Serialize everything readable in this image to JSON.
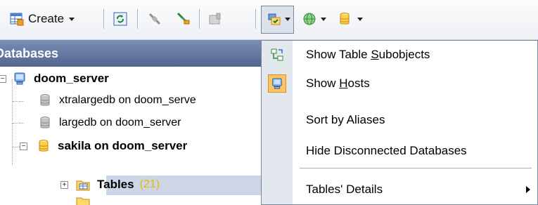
{
  "toolbar": {
    "create_label": "Create",
    "buttons": [
      {
        "icon": "create-table-icon",
        "caret": true
      },
      {
        "icon": "refresh-icon"
      },
      {
        "icon": "disconnect-icon"
      },
      {
        "icon": "connect-icon"
      },
      {
        "icon": "properties-icon"
      },
      {
        "icon": "view-options-icon",
        "caret": true,
        "pressed": true
      },
      {
        "icon": "globe-icon",
        "caret": true
      },
      {
        "icon": "database-icon",
        "caret": true
      }
    ]
  },
  "panel": {
    "title": "Databases",
    "tree": [
      {
        "label": "doom_server",
        "icon": "server-icon",
        "bold": true,
        "level": 0
      },
      {
        "label": "xtralargedb on doom_serve",
        "icon": "database-icon",
        "level": 1
      },
      {
        "label": "largedb on doom_server",
        "icon": "database-icon",
        "level": 1
      },
      {
        "label": "sakila on doom_server",
        "icon": "database-icon",
        "bold": true,
        "level": 1
      },
      {
        "label": "Tables",
        "count": "(21)",
        "icon": "folder-table-icon",
        "bold": true,
        "level": 2,
        "selected": true
      }
    ]
  },
  "menu": {
    "items": [
      {
        "before": "Show Table ",
        "mnemonic": "S",
        "after": "ubobjects",
        "icon": "subobjects-icon"
      },
      {
        "before": "Show ",
        "mnemonic": "H",
        "after": "osts",
        "icon": "host-icon",
        "checked": true
      },
      {
        "before": "Sort by Aliases",
        "mnemonic": "",
        "after": ""
      },
      {
        "before": "Hide Disconnected Databases",
        "mnemonic": "",
        "after": ""
      },
      {
        "before": "Tables' Details",
        "mnemonic": "",
        "after": "",
        "submenu": true
      }
    ]
  },
  "colors": {
    "panel_title_top": "#7b8fb5",
    "panel_title_bottom": "#51658f",
    "selection": "#cdd6e6",
    "menu_gutter": "#e3e7ee",
    "checked_icon_bg": "#ffc466",
    "count_text": "#e6b800"
  }
}
